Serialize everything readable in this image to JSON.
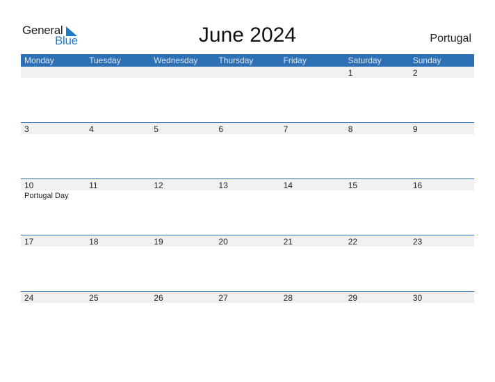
{
  "logo": {
    "text_general": "General",
    "text_blue": "Blue",
    "icon": "triangle-flag-icon"
  },
  "title": "June 2024",
  "country": "Portugal",
  "colors": {
    "header": "#2e70b4",
    "strip": "#f0f0f0",
    "logo_blue": "#1e7bc8"
  },
  "days": [
    "Monday",
    "Tuesday",
    "Wednesday",
    "Thursday",
    "Friday",
    "Saturday",
    "Sunday"
  ],
  "weeks": [
    [
      "",
      "",
      "",
      "",
      "",
      "1",
      "2"
    ],
    [
      "3",
      "4",
      "5",
      "6",
      "7",
      "8",
      "9"
    ],
    [
      "10",
      "11",
      "12",
      "13",
      "14",
      "15",
      "16"
    ],
    [
      "17",
      "18",
      "19",
      "20",
      "21",
      "22",
      "23"
    ],
    [
      "24",
      "25",
      "26",
      "27",
      "28",
      "29",
      "30"
    ]
  ],
  "events": [
    {
      "week": 2,
      "day": 0,
      "label": "Portugal Day"
    }
  ]
}
